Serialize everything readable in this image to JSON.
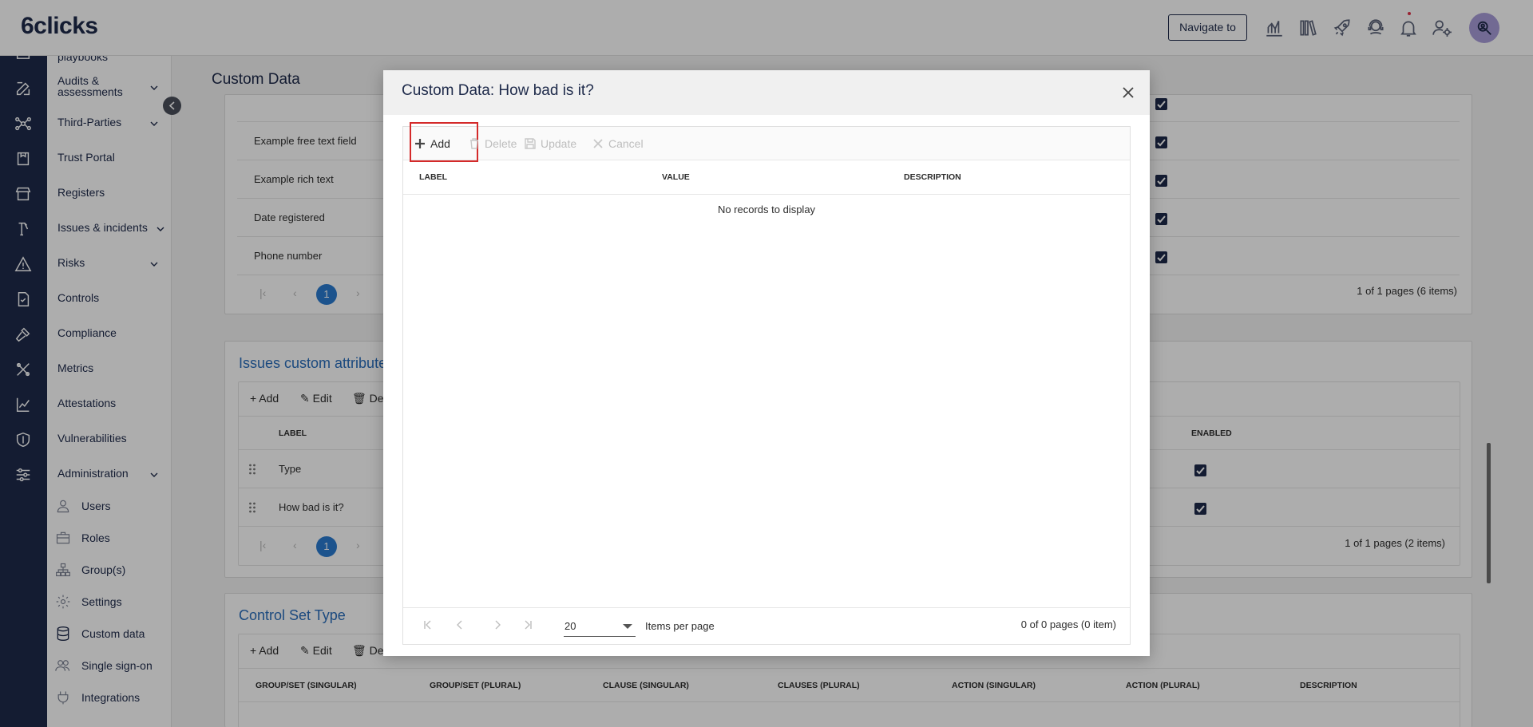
{
  "app": {
    "logo": "6clicks",
    "navigate_label": "Navigate to",
    "accent": "#1e2a4a",
    "link_color": "#2a6ebb"
  },
  "topbar_icons": [
    "analytics-icon",
    "library-icon",
    "rocket-icon",
    "support-icon",
    "bell-icon",
    "user-settings-icon"
  ],
  "rail_icons": [
    "grid-icon",
    "edit-icon",
    "network-icon",
    "vendor-icon",
    "store-icon",
    "tools-icon",
    "warning-icon",
    "document-check-icon",
    "hammer-icon",
    "wrench-icon",
    "chart-icon",
    "shield-icon",
    "sliders-icon"
  ],
  "sidebar": {
    "items": [
      {
        "label": "playbooks"
      },
      {
        "label": "Audits &"
      },
      {
        "label": "assessments"
      },
      {
        "label": "Third-Parties"
      },
      {
        "label": "Trust Portal"
      },
      {
        "label": "Registers"
      },
      {
        "label": "Issues & incidents"
      },
      {
        "label": "Risks"
      },
      {
        "label": "Controls"
      },
      {
        "label": "Compliance"
      },
      {
        "label": "Metrics"
      },
      {
        "label": "Attestations"
      },
      {
        "label": "Vulnerabilities"
      },
      {
        "label": "Administration"
      }
    ],
    "subitems": [
      {
        "label": "Users",
        "icon": "user-icon"
      },
      {
        "label": "Roles",
        "icon": "briefcase-icon"
      },
      {
        "label": "Group(s)",
        "icon": "hierarchy-icon"
      },
      {
        "label": "Settings",
        "icon": "gear-icon"
      },
      {
        "label": "Custom data",
        "icon": "database-icon"
      },
      {
        "label": "Single sign-on",
        "icon": "users-icon"
      },
      {
        "label": "Integrations",
        "icon": "plug-icon"
      }
    ]
  },
  "main": {
    "page_title": "Custom Data",
    "top_card": {
      "rows": [
        "Example free text field",
        "Example rich text",
        "Date registered",
        "Phone number"
      ],
      "page_number": "1",
      "page_info": "1 of 1 pages (6 items)"
    },
    "issues_card": {
      "title": "Issues custom attribute",
      "toolbar": {
        "add": "Add",
        "edit": "Edit",
        "delete": "Del"
      },
      "columns": {
        "label": "LABEL",
        "enabled": "ENABLED"
      },
      "rows": [
        "Type",
        "How bad is it?"
      ],
      "page_number": "1",
      "page_info": "1 of 1 pages (2 items)"
    },
    "control_set_card": {
      "title": "Control Set Type",
      "toolbar": {
        "add": "Add",
        "edit": "Edit",
        "delete": "Del"
      },
      "columns": [
        "GROUP/SET (SINGULAR)",
        "GROUP/SET (PLURAL)",
        "CLAUSE (SINGULAR)",
        "CLAUSES (PLURAL)",
        "ACTION (SINGULAR)",
        "ACTION (PLURAL)",
        "DESCRIPTION"
      ]
    }
  },
  "modal": {
    "title": "Custom Data: How bad is it?",
    "toolbar": {
      "add": "Add",
      "delete": "Delete",
      "update": "Update",
      "cancel": "Cancel"
    },
    "columns": {
      "label": "LABEL",
      "value": "VALUE",
      "description": "DESCRIPTION"
    },
    "empty_message": "No records to display",
    "footer": {
      "page_size": "20",
      "items_per_page_label": "Items per page",
      "page_info": "0 of 0 pages (0 item)"
    },
    "highlight_color": "#d42a2a"
  }
}
